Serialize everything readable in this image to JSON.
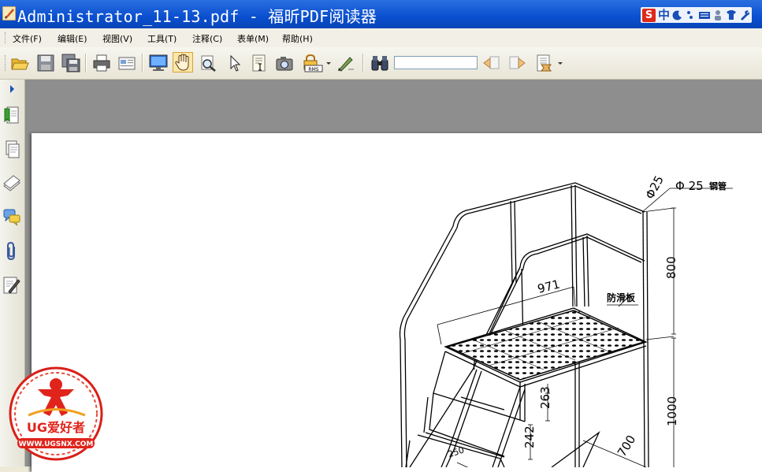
{
  "window": {
    "title": "Administrator_11-13.pdf - 福昕PDF阅读器",
    "ime_label": "中"
  },
  "menu": {
    "items": [
      "文件(F)",
      "编辑(E)",
      "视图(V)",
      "工具(T)",
      "注释(C)",
      "表单(M)",
      "帮助(H)"
    ]
  },
  "toolbar": {
    "search_value": "",
    "rms_label": "RMS",
    "buttons": [
      "open-icon",
      "save-icon",
      "save-all-icon",
      "print-icon",
      "email-icon",
      "fullscreen-icon",
      "hand-tool-icon",
      "zoom-glass-icon",
      "select-arrow-icon",
      "text-select-icon",
      "snapshot-icon",
      "rms-lock-icon",
      "signature-pen-icon",
      "find-binoculars-icon",
      "search-prev-icon",
      "search-next-icon",
      "document-properties-icon"
    ]
  },
  "sidebar": {
    "buttons": [
      "expand-arrow-icon",
      "bookmarks-icon",
      "pages-icon",
      "layers-icon",
      "comments-icon",
      "attachments-icon",
      "signatures-icon"
    ]
  },
  "drawing": {
    "labels": {
      "pipe_dia_small": "Φ25",
      "pipe_dia": "Φ 25",
      "pipe_material": "钢管",
      "width": "971",
      "anti_slip": "防滑板",
      "rail_height": "800",
      "platform_height": "1000",
      "step_rise_1": "263",
      "step_rise_2": "242",
      "depth": "700",
      "step_depth": "250"
    }
  },
  "watermark": {
    "brand": "UG爱好者",
    "url": "WWW.UGSNX.COM"
  }
}
